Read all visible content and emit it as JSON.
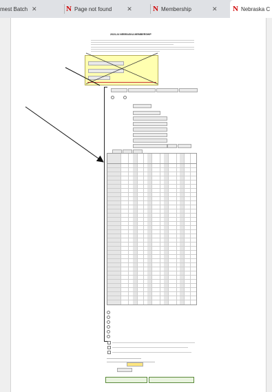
{
  "browser": {
    "tabs": [
      {
        "label": "mest Batch",
        "close": "✕"
      },
      {
        "label": "Page not found",
        "close": "✕"
      },
      {
        "label": "Membership",
        "close": "✕"
      },
      {
        "label": "Nebraska C",
        "close": "✕"
      }
    ],
    "logo_letter": "N"
  },
  "form": {
    "heading": "2023-24 NEBRASKA MEMBERSHIP"
  },
  "colors": {
    "logo_red": "#d00000",
    "highlight_yellow": "#ffffb0",
    "button_green": "#5a8a3a"
  }
}
